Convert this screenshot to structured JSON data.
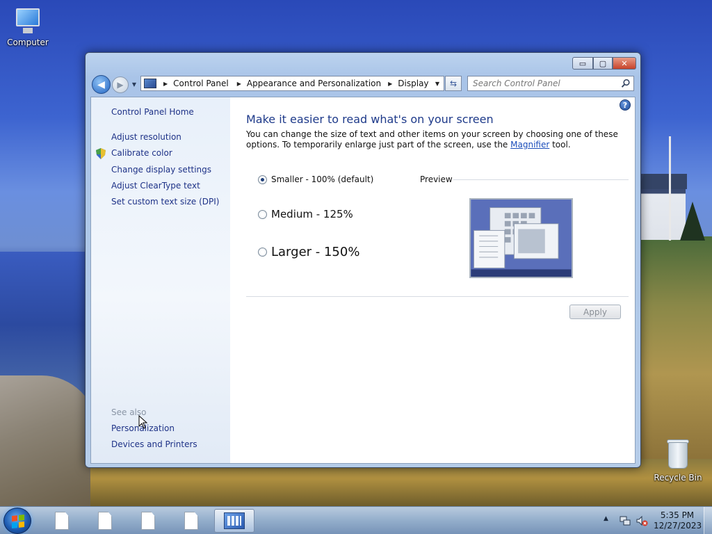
{
  "desktop": {
    "computer_label": "Computer",
    "recycle_bin_label": "Recycle Bin"
  },
  "window": {
    "controls": {
      "minimize": "▭",
      "maximize": "▢",
      "close": "✕"
    },
    "address": {
      "crumbs": [
        "Control Panel",
        "Appearance and Personalization",
        "Display"
      ]
    },
    "search": {
      "placeholder": "Search Control Panel"
    }
  },
  "sidebar": {
    "home": "Control Panel Home",
    "links": [
      "Adjust resolution",
      "Calibrate color",
      "Change display settings",
      "Adjust ClearType text",
      "Set custom text size (DPI)"
    ],
    "see_also_heading": "See also",
    "see_also": [
      "Personalization",
      "Devices and Printers"
    ]
  },
  "main": {
    "title": "Make it easier to read what's on your screen",
    "description_pre": "You can change the size of text and other items on your screen by choosing one of these options. To temporarily enlarge just part of the screen, use the ",
    "description_link": "Magnifier",
    "description_post": " tool.",
    "options": [
      {
        "label": "Smaller - 100% (default)",
        "selected": true
      },
      {
        "label": "Medium - 125%",
        "selected": false
      },
      {
        "label": "Larger - 150%",
        "selected": false
      }
    ],
    "preview_label": "Preview",
    "apply_label": "Apply",
    "help": "?"
  },
  "taskbar": {
    "time": "5:35 PM",
    "date": "12/27/2023"
  }
}
